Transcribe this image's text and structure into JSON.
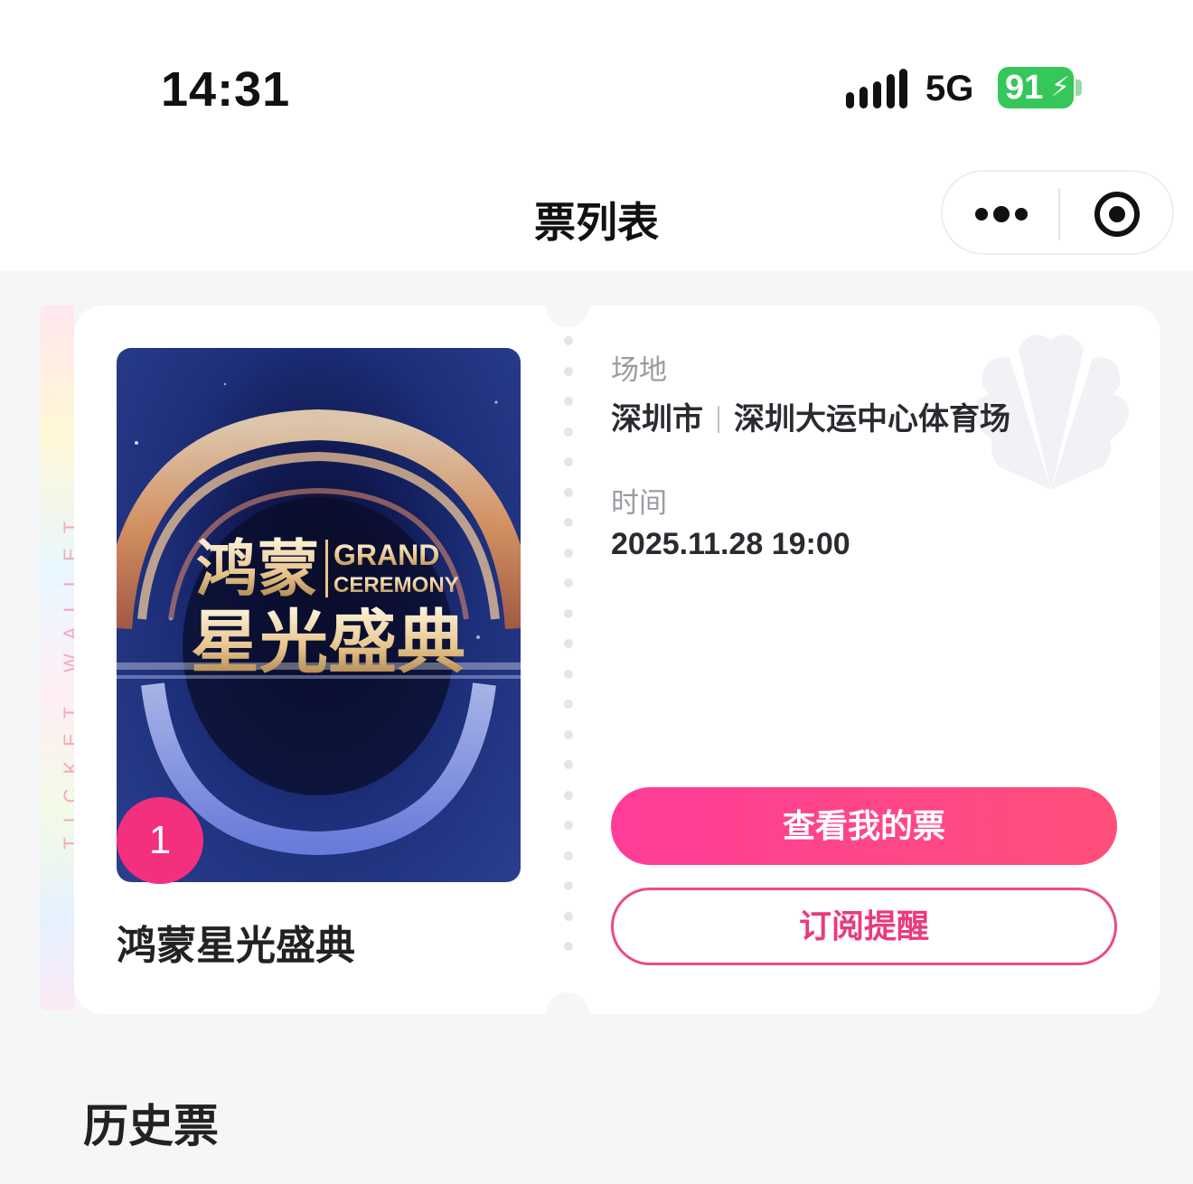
{
  "status_bar": {
    "time": "14:31",
    "network": "5G",
    "battery": "91"
  },
  "nav": {
    "title": "票列表",
    "more_icon": "more-dots-icon",
    "close_icon": "target-circle-icon"
  },
  "ticket_strip": {
    "text": "TICKET WALLET"
  },
  "ticket": {
    "poster": {
      "title_cn_line1": "鸿蒙",
      "title_en_line1": "GRAND",
      "title_en_line2": "CEREMONY",
      "title_cn_line2": "星光盛典"
    },
    "count": "1",
    "event_name": "鸿蒙星光盛典",
    "venue_label": "场地",
    "city": "深圳市",
    "venue": "深圳大运中心体育场",
    "time_label": "时间",
    "time": "2025.11.28 19:00",
    "view_button": "查看我的票",
    "subscribe_button": "订阅提醒",
    "colors": {
      "primary_gradient_start": "#ff3c98",
      "primary_gradient_end": "#ff4f7a",
      "badge": "#f42f7e"
    }
  },
  "history": {
    "title": "历史票"
  }
}
